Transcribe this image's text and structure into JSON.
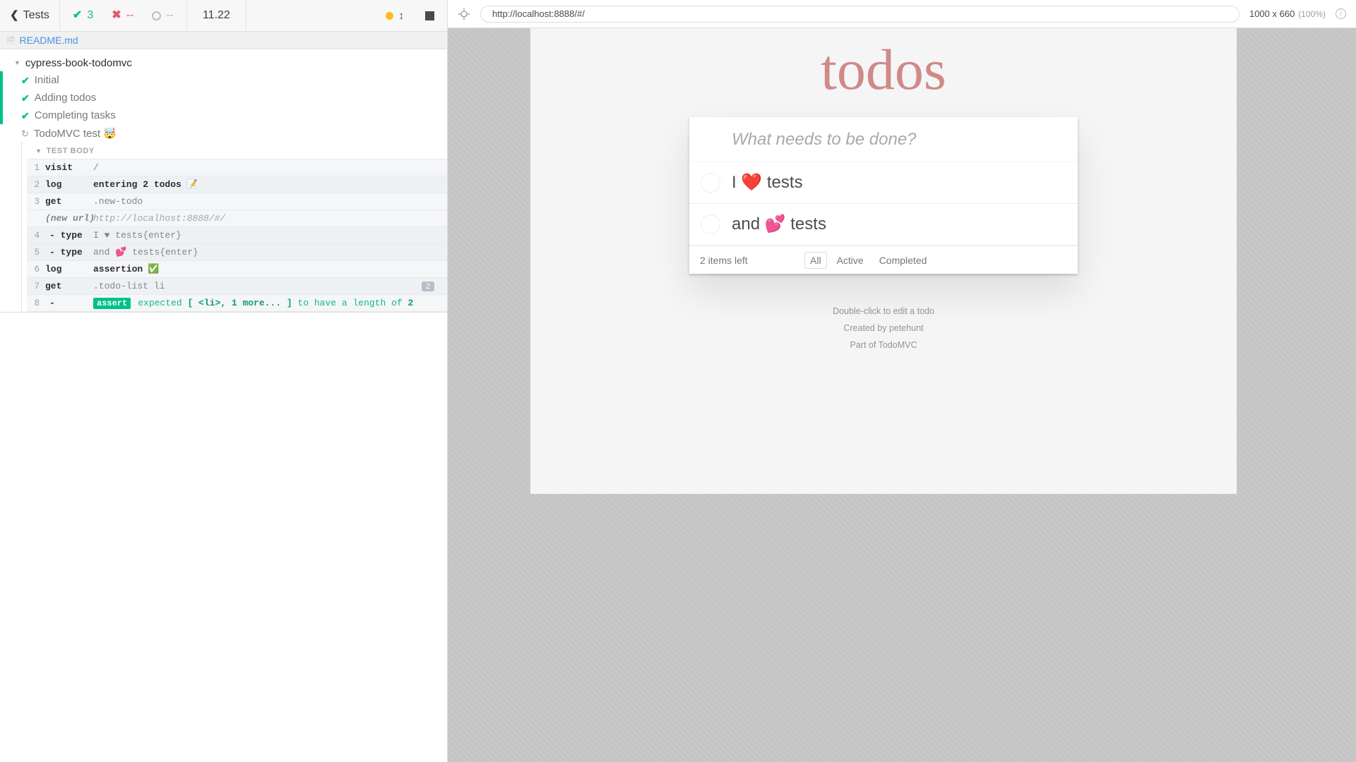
{
  "reporter": {
    "back_label": "Tests",
    "back_icon": "chevron-left-icon",
    "stats": {
      "passed": {
        "icon": "check-icon",
        "value": "3"
      },
      "failed": {
        "icon": "x-icon",
        "value": "--"
      },
      "pending": {
        "icon": "circle-icon",
        "value": "--"
      }
    },
    "duration": "11.22",
    "controls": {
      "studio_dot": "amber-dot-icon",
      "auto_scroll": "auto-scroll-icon",
      "stop": "stop-square-icon"
    },
    "readme": {
      "icon": "file-icon",
      "label": "README.md"
    },
    "suite": {
      "caret": "caret-down-icon",
      "title": "cypress-book-todomvc",
      "tests": [
        {
          "state": "passed",
          "icon": "check-icon",
          "label": "Initial"
        },
        {
          "state": "passed",
          "icon": "check-icon",
          "label": "Adding todos"
        },
        {
          "state": "passed",
          "icon": "check-icon",
          "label": "Completing tasks"
        },
        {
          "state": "running",
          "icon": "spinner-icon",
          "label": "TodoMVC test 🤯"
        }
      ]
    },
    "test_body_label": "TEST BODY",
    "commands": [
      {
        "num": "1",
        "name": "visit",
        "message": "/",
        "style": "plain"
      },
      {
        "num": "2",
        "name": "log",
        "message": "entering 2 todos",
        "emoji": "📝",
        "style": "bold"
      },
      {
        "num": "3",
        "name": "get",
        "message": ".new-todo",
        "style": "plain"
      },
      {
        "num": "",
        "name": "(new url)",
        "message": "http://localhost:8888/#/",
        "style": "url"
      },
      {
        "num": "4",
        "name": "- type",
        "message": "I ♥ tests{enter}",
        "style": "plain"
      },
      {
        "num": "5",
        "name": "- type",
        "message": "and 💕 tests{enter}",
        "style": "plain"
      },
      {
        "num": "6",
        "name": "log",
        "message": "assertion",
        "emoji": "✅",
        "style": "bold"
      },
      {
        "num": "7",
        "name": "get",
        "message": ".todo-list li",
        "style": "plain",
        "badge": "2"
      },
      {
        "num": "8",
        "name": "- ",
        "badge_label": "assert",
        "message_pre": "expected ",
        "message_code": "[ <li>, 1 more... ]",
        "message_post": " to have a length of ",
        "message_value": "2",
        "style": "assert"
      }
    ]
  },
  "aut": {
    "selector_playground_icon": "crosshair-icon",
    "url": "http://localhost:8888/#/",
    "viewport_size": "1000 x 660",
    "viewport_scale": "(100%)",
    "info_icon": "info-icon"
  },
  "todoapp": {
    "title": "todos",
    "new_todo_placeholder": "What needs to be done?",
    "new_todo_value": "",
    "items": [
      {
        "label": "I ❤️ tests",
        "completed": false
      },
      {
        "label": "and 💕 tests",
        "completed": false
      }
    ],
    "count_text": "2 items left",
    "filters": [
      {
        "label": "All",
        "selected": true
      },
      {
        "label": "Active",
        "selected": false
      },
      {
        "label": "Completed",
        "selected": false
      }
    ],
    "info": [
      "Double-click to edit a todo",
      "Created by petehunt",
      "Part of TodoMVC"
    ]
  }
}
